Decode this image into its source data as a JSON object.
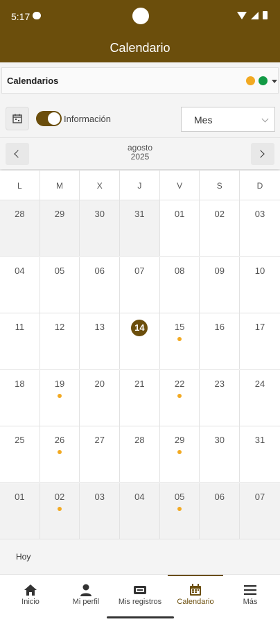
{
  "status": {
    "time": "5:17"
  },
  "app": {
    "title": "Calendario"
  },
  "calendars": {
    "label": "Calendarios",
    "colors": [
      "#f2a922",
      "#129a45"
    ]
  },
  "controls": {
    "info_label": "Información",
    "info_toggle_on": true,
    "view_value": "Mes"
  },
  "month_nav": {
    "month": "agosto",
    "year": "2025"
  },
  "weekdays": [
    "L",
    "M",
    "X",
    "J",
    "V",
    "S",
    "D"
  ],
  "weeks": [
    [
      {
        "n": "28",
        "muted": true
      },
      {
        "n": "29",
        "muted": true
      },
      {
        "n": "30",
        "muted": true
      },
      {
        "n": "31",
        "muted": true
      },
      {
        "n": "01"
      },
      {
        "n": "02"
      },
      {
        "n": "03"
      }
    ],
    [
      {
        "n": "04"
      },
      {
        "n": "05"
      },
      {
        "n": "06"
      },
      {
        "n": "07"
      },
      {
        "n": "08"
      },
      {
        "n": "09"
      },
      {
        "n": "10"
      }
    ],
    [
      {
        "n": "11"
      },
      {
        "n": "12"
      },
      {
        "n": "13"
      },
      {
        "n": "14",
        "today": true
      },
      {
        "n": "15",
        "event": true
      },
      {
        "n": "16"
      },
      {
        "n": "17"
      }
    ],
    [
      {
        "n": "18"
      },
      {
        "n": "19",
        "event": true
      },
      {
        "n": "20"
      },
      {
        "n": "21"
      },
      {
        "n": "22",
        "event": true
      },
      {
        "n": "23"
      },
      {
        "n": "24"
      }
    ],
    [
      {
        "n": "25"
      },
      {
        "n": "26",
        "event": true
      },
      {
        "n": "27"
      },
      {
        "n": "28"
      },
      {
        "n": "29",
        "event": true
      },
      {
        "n": "30"
      },
      {
        "n": "31"
      }
    ],
    [
      {
        "n": "01",
        "muted": true
      },
      {
        "n": "02",
        "muted": true,
        "event": true
      },
      {
        "n": "03",
        "muted": true
      },
      {
        "n": "04",
        "muted": true
      },
      {
        "n": "05",
        "muted": true,
        "event": true
      },
      {
        "n": "06",
        "muted": true
      },
      {
        "n": "07",
        "muted": true
      }
    ]
  ],
  "hoy": "Hoy",
  "bottom_nav": [
    {
      "label": "Inicio",
      "icon": "home-icon"
    },
    {
      "label": "Mi perfil",
      "icon": "person-icon"
    },
    {
      "label": "Mis registros",
      "icon": "ticket-icon"
    },
    {
      "label": "Calendario",
      "icon": "calendar-icon",
      "active": true
    },
    {
      "label": "Más",
      "icon": "menu-icon"
    }
  ],
  "colors": {
    "brand": "#6b4e0c",
    "event": "#f2a922"
  }
}
